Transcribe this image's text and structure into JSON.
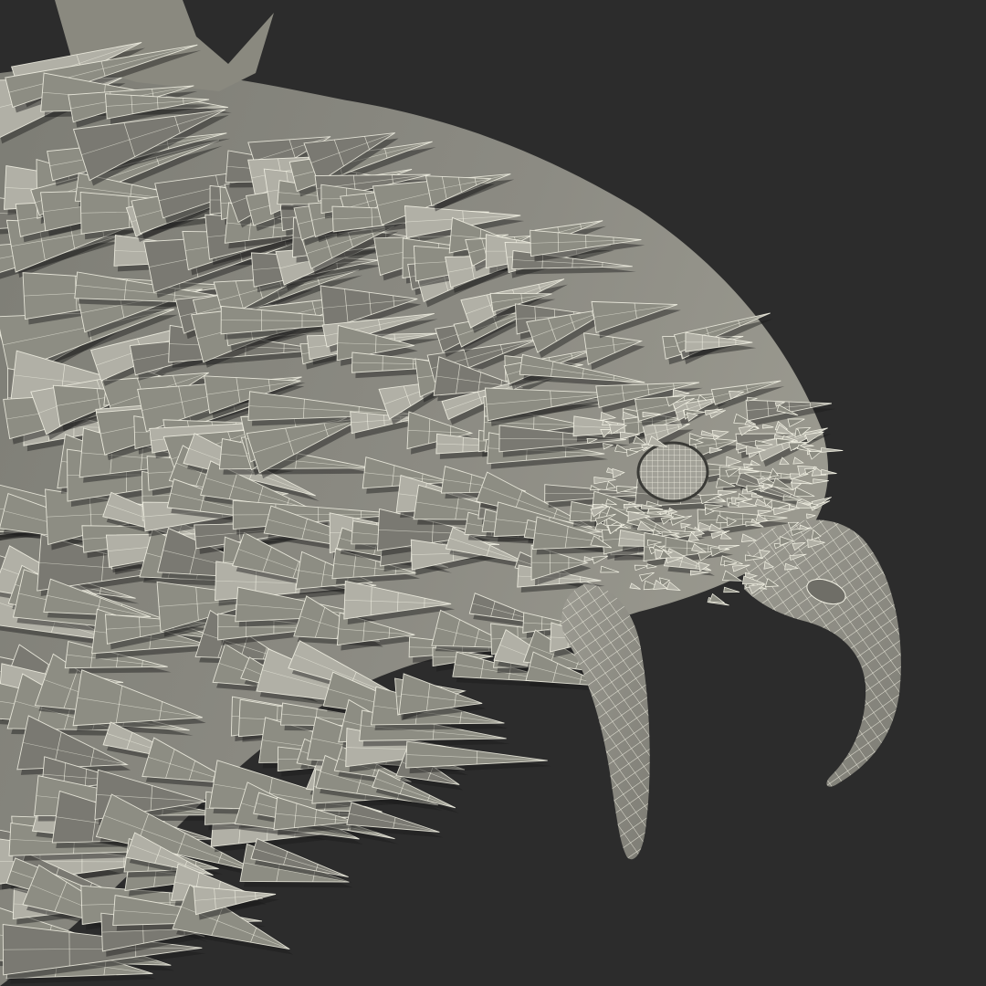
{
  "scene": {
    "subject": "eagle-head-wireframe",
    "colors": {
      "background": "#2c2c2c",
      "surface": "#8d8d83",
      "surface_light": "#b1b0a6",
      "surface_dark": "#5d5d56",
      "shadow": "#1b1b1a",
      "wire": "#f4f3e6"
    }
  }
}
